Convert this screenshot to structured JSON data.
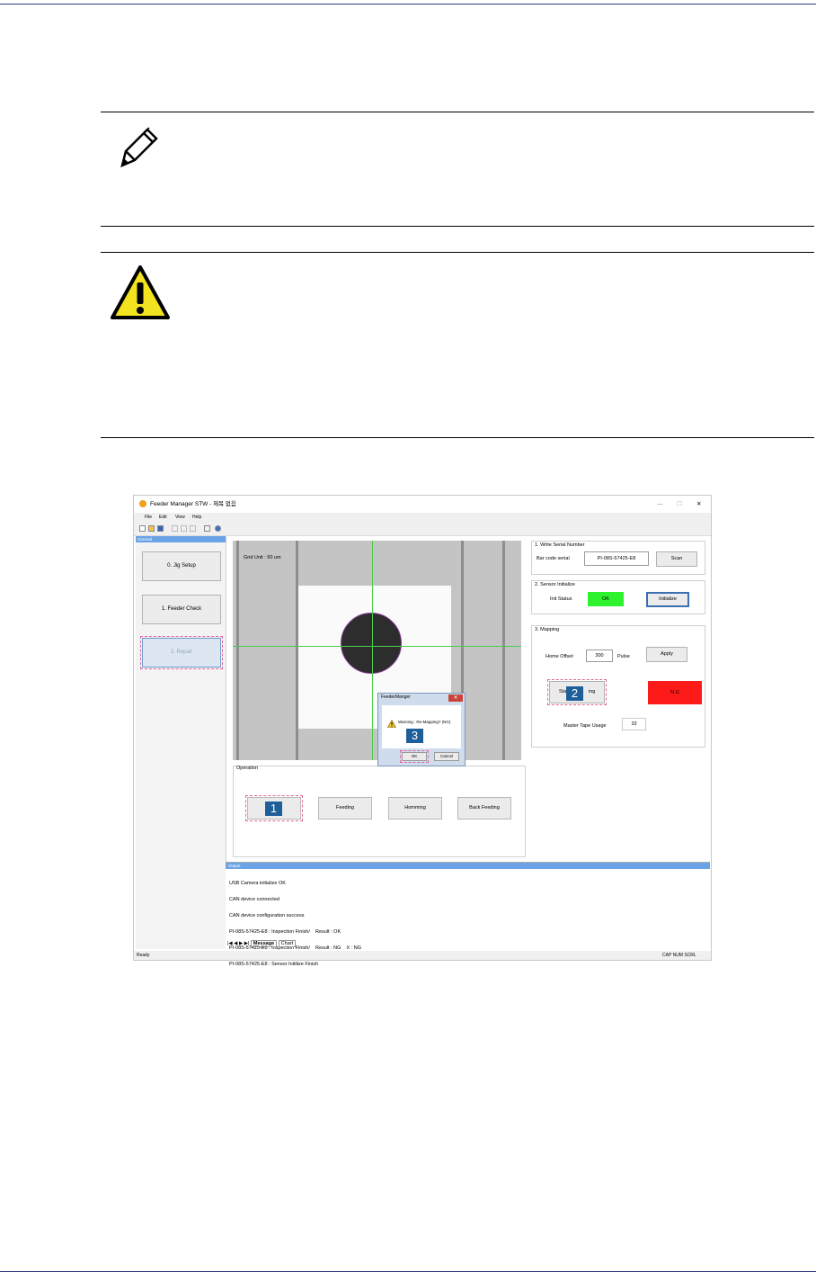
{
  "window": {
    "title": "Feeder Manager STW - 제목 없음",
    "menu": [
      "File",
      "Edit",
      "View",
      "Help"
    ],
    "left_panel": {
      "header": "General",
      "items": [
        "0. Jig Setup",
        "1. Feeder Check",
        "2. Repair"
      ],
      "selected": "2. Repair"
    },
    "camera": {
      "grid_label": "Grid Unit : 50 um"
    },
    "operation": {
      "title": "Operation",
      "buttons": [
        "Feeding",
        "Homming",
        "Back Feeding"
      ]
    },
    "serial": {
      "title": "1. Write Serial Number",
      "label": "Bar code serial",
      "value": "PI-08S-57425-E8",
      "scan": "Scan"
    },
    "sensor": {
      "title": "2. Sensor Initialize",
      "label": "Init Status",
      "status": "OK",
      "status_color": "#2ef22e",
      "initialize": "Initialize"
    },
    "mapping": {
      "title": "3. Mapping",
      "home_offset_label": "Home Offset",
      "home_offset_value": "300",
      "pulse_label": "Pulse",
      "apply": "Apply",
      "start_prefix": "Sta",
      "start_suffix": "ing",
      "result": "N.G",
      "result_color": "#ff1a1a",
      "master_tape_label": "Master Tape Usage",
      "master_tape_value": "33"
    },
    "dialog": {
      "title": "FeederManger",
      "message": "Warning : Re-Mapping? (NG)",
      "ok": "OK",
      "cancel": "Cancel"
    },
    "output": {
      "header": "Output",
      "lines": [
        "USB Camera initialize OK",
        "CAN device connected",
        "CAN device configuration success",
        "PI-08S-57425-E8 : Inspection Finish/    Result : OK",
        "PI-08S-57425-E8 : Inspection Finish/    Result : NG    X : NG",
        "PI-08S-57425-E8 : Sensor Initilize Finish"
      ],
      "tabs": [
        "Message",
        "Chart"
      ]
    },
    "status": {
      "left": "Ready",
      "right": "CAP  NUM  SCRL"
    }
  },
  "markers": [
    "1",
    "2",
    "3"
  ]
}
